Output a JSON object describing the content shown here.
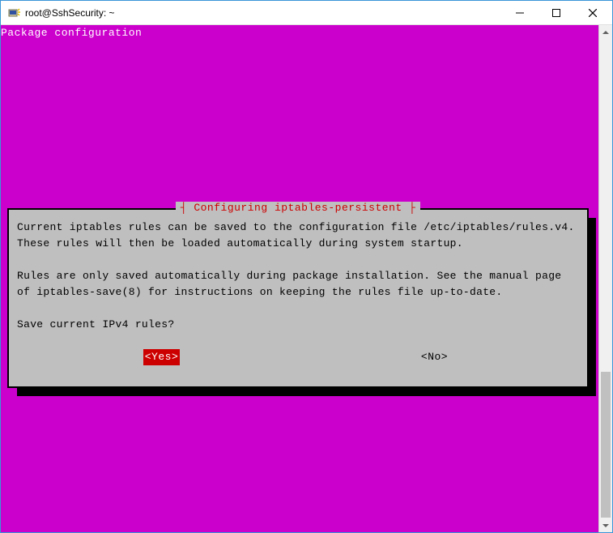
{
  "window": {
    "title": "root@SshSecurity: ~"
  },
  "header": {
    "text": "Package configuration"
  },
  "dialog": {
    "title": "Configuring iptables-persistent",
    "para1": "Current iptables rules can be saved to the configuration file /etc/iptables/rules.v4. These rules will then be loaded automatically during system startup.",
    "para2": "Rules are only saved automatically during package installation. See the manual page of iptables-save(8) for instructions on keeping the rules file up-to-date.",
    "question": "Save current IPv4 rules?",
    "yes_label": "<Yes>",
    "no_label": "<No>"
  }
}
